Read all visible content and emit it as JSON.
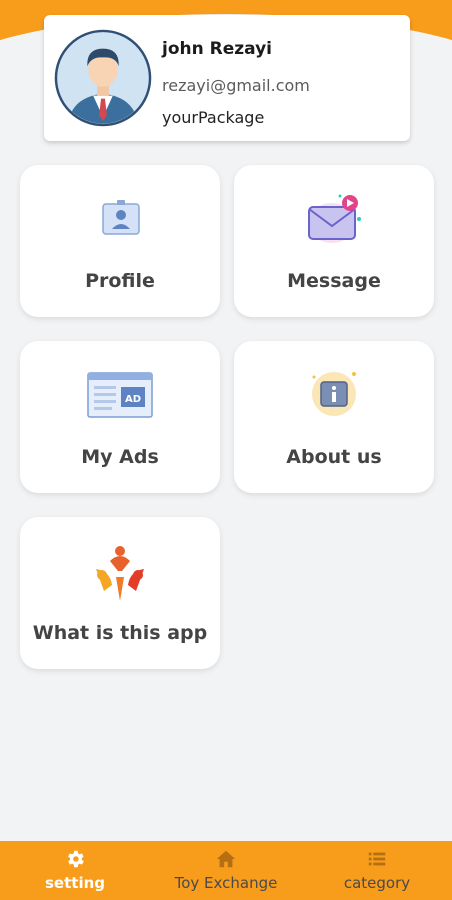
{
  "user": {
    "name": "john Rezayi",
    "email": "rezayi@gmail.com",
    "package": "yourPackage"
  },
  "menu": {
    "profile": "Profile",
    "message": "Message",
    "my_ads": "My Ads",
    "about_us": "About us",
    "what_is_this_app": "What is this app"
  },
  "nav": {
    "setting": "setting",
    "toy_exchange": "Toy Exchange",
    "category": "category",
    "active": "setting"
  },
  "colors": {
    "accent": "#f89c1c",
    "background": "#f2f3f5"
  }
}
